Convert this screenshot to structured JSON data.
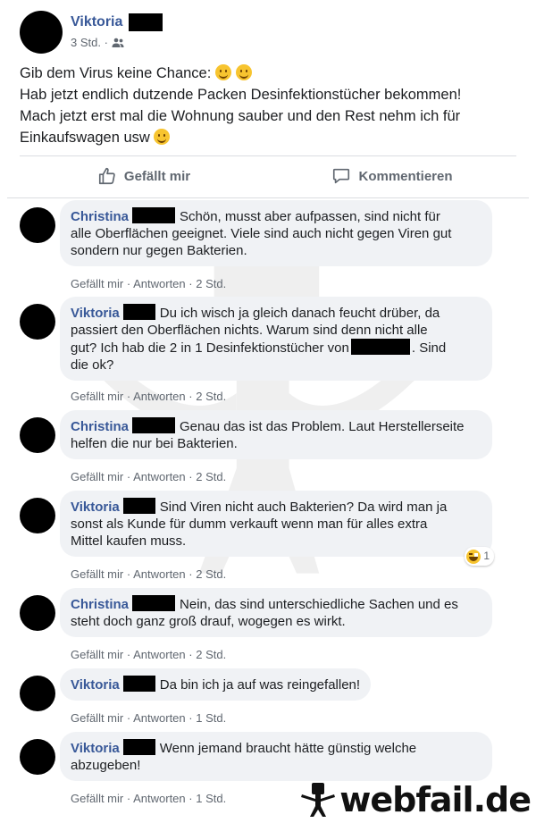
{
  "post": {
    "author": "Viktoria",
    "time": "3 Std. ·",
    "audience_icon": "friends-icon",
    "text_lines": [
      "Gib dem Virus keine Chance:",
      "Hab jetzt endlich dutzende Packen Desinfektionstücher bekommen!",
      "Mach jetzt erst mal die Wohnung sauber und den Rest nehm ich für",
      "Einkaufswagen usw"
    ]
  },
  "actions": {
    "like_label": "Gefällt mir",
    "comment_label": "Kommentieren"
  },
  "comment_actions": {
    "like": "Gefällt mir",
    "sep": "·",
    "reply": "Antworten"
  },
  "comments": [
    {
      "author": "Christina",
      "lines": [
        "Schön, musst aber aufpassen, sind nicht für",
        "alle Oberflächen geeignet. Viele sind auch nicht gegen Viren gut",
        "sondern nur gegen Bakterien."
      ],
      "time": "· 2 Std."
    },
    {
      "author": "Viktoria",
      "lines": [
        "Du ich wisch ja gleich danach feucht drüber, da",
        "passiert den Oberflächen nichts. Warum sind denn nicht alle",
        "gut? Ich hab die 2 in 1 Desinfektionstücher von",
        ". Sind",
        "die ok?"
      ],
      "time": "· 2 Std."
    },
    {
      "author": "Christina",
      "lines": [
        "Genau das ist das Problem. Laut Herstellerseite",
        "helfen die nur bei Bakterien."
      ],
      "time": "· 2 Std."
    },
    {
      "author": "Viktoria",
      "lines": [
        "Sind Viren nicht auch Bakterien? Da wird man ja",
        "sonst als Kunde für dumm verkauft wenn man für alles extra",
        "Mittel kaufen muss."
      ],
      "time": "· 2 Std.",
      "reaction_count": "1"
    },
    {
      "author": "Christina",
      "lines": [
        "Nein, das sind unterschiedliche Sachen und es",
        "steht doch ganz groß drauf, wogegen es wirkt."
      ],
      "time": "· 2 Std."
    },
    {
      "author": "Viktoria",
      "lines": [
        "Da bin ich ja auf was reingefallen!"
      ],
      "time": "· 1 Std."
    },
    {
      "author": "Viktoria",
      "lines": [
        "Wenn jemand braucht hätte günstig welche",
        "abzugeben!"
      ],
      "time": "· 1 Std."
    }
  ],
  "brand": {
    "text": "webfail.de"
  }
}
